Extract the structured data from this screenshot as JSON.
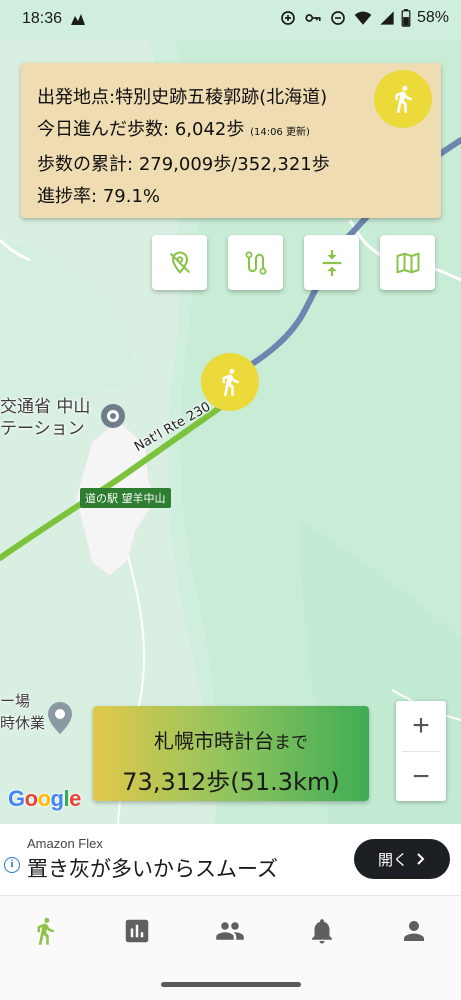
{
  "status_bar": {
    "time": "18:36",
    "battery": "58%"
  },
  "info_card": {
    "departure_label": "出発地点:",
    "departure_value": "特別史跡五稜郭跡(北海道)",
    "today_label": "今日進んだ歩数:",
    "today_value": "6,042歩",
    "today_updated": "(14:06 更新)",
    "cumulative_label": "歩数の累計:",
    "cumulative_value": "279,009歩/352,321歩",
    "progress_label": "進捗率:",
    "progress_value": "79.1%"
  },
  "map": {
    "poi_station_line1": "交通省 中山",
    "poi_station_line2": "テーション",
    "station_tag": "道の駅 望羊中山",
    "road_label": "Nat'l Rte 230",
    "poi_lower_line1": "ー場",
    "poi_lower_line2": "時休業",
    "google": [
      "G",
      "o",
      "o",
      "g",
      "l",
      "e"
    ]
  },
  "toolbar": [
    {
      "name": "location-off-button",
      "icon": "location-off-icon"
    },
    {
      "name": "route-button",
      "icon": "route-icon"
    },
    {
      "name": "compress-button",
      "icon": "vertical-align-center-icon"
    },
    {
      "name": "map-button",
      "icon": "map-icon"
    }
  ],
  "destination": {
    "name": "札幌市時計台",
    "suffix": "まで",
    "remaining": "73,312歩(51.3km)"
  },
  "zoom": {
    "in": "+",
    "out": "−"
  },
  "ad": {
    "brand": "Amazon Flex",
    "headline": "置き灰が多いからスムーズ",
    "cta": "開く"
  },
  "bottom_nav": [
    {
      "name": "nav-walk",
      "icon": "walk-icon",
      "active": true
    },
    {
      "name": "nav-stats",
      "icon": "bar-chart-icon",
      "active": false
    },
    {
      "name": "nav-friends",
      "icon": "group-icon",
      "active": false
    },
    {
      "name": "nav-notifications",
      "icon": "bell-icon",
      "active": false
    },
    {
      "name": "nav-profile",
      "icon": "person-icon",
      "active": false
    }
  ],
  "colors": {
    "card": "#efdcb2",
    "walker": "#ecd93a",
    "route_walked": "#7cc23a",
    "route_remaining": "#6d86b0",
    "map_land": "#cfeedd",
    "active_nav": "#8bc34a"
  }
}
